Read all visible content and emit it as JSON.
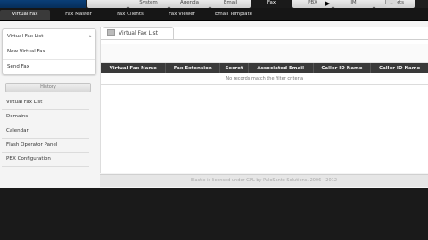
{
  "top_tabs": [
    "",
    "System",
    "Agenda",
    "Email",
    "Fax",
    "PBX",
    "IM",
    "Reports"
  ],
  "top_tab_active_index": 4,
  "top_right_icon": "chevron-down-icon",
  "sub_tabs": [
    "Virtual Fax",
    "Fax Master",
    "Fax Clients",
    "Fax Viewer",
    "Email Template"
  ],
  "sub_tab_active_index": 0,
  "sidebar": {
    "menu": [
      "Virtual Fax List",
      "New Virtual Fax",
      "Send Fax"
    ],
    "history_title": "History",
    "history_items": [
      "Virtual Fax List",
      "Domains",
      "Calendar",
      "Flash Operator Panel",
      "PBX Configuration"
    ]
  },
  "main": {
    "tab_title": "Virtual Fax List",
    "columns": [
      "Virtual Fax Name",
      "Fax Extension",
      "Secret",
      "Associated Email",
      "Caller ID Name",
      "Caller ID Name"
    ],
    "empty_message": "No records match the filter criteria"
  },
  "footer": "Elastix is licensed under GPL by PaloSanto Solutions. 2006 - 2012",
  "colors": {
    "header_dark": "#161616",
    "active_tab": "#1a1a1a",
    "logo_blue": "#0a3f78"
  }
}
